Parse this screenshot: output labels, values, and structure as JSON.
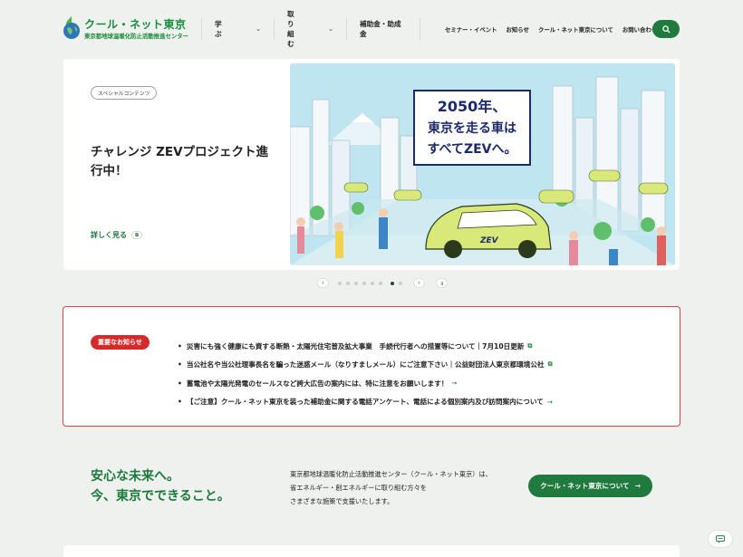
{
  "header": {
    "logo_title": "クール・ネット東京",
    "logo_subtitle": "東京都地球温暖化防止活動推進センター",
    "nav_main": [
      {
        "label": "学ぶ",
        "has_dropdown": true
      },
      {
        "label": "取り組む",
        "has_dropdown": true
      },
      {
        "label": "補助金・助成金",
        "has_dropdown": false
      }
    ],
    "nav_sub": [
      "セミナー・イベント",
      "お知らせ",
      "クール・ネット東京について",
      "お問い合わせ"
    ],
    "search_icon": "search-icon"
  },
  "hero": {
    "tag": "スペシャルコンテンツ",
    "title": "チャレンジ ZEVプロジェクト進行中！",
    "more_label": "詳しく見る",
    "banner_text_line1": "2050年、",
    "banner_text_line2": "東京を走る車は",
    "banner_text_line3": "すべてZEVへ。",
    "car_label": "ZEV"
  },
  "carousel": {
    "prev": "‹",
    "next": "›",
    "pause": "॥",
    "dot_count": 7,
    "active_index": 6
  },
  "notice": {
    "badge": "重要なお知らせ",
    "items": [
      {
        "text": "災害にも強く健康にも資する断熱・太陽光住宅普及拡大事業　手続代行者への措置等について｜7月10日更新",
        "marker": "⧉"
      },
      {
        "text": "当公社名や当公社理事長名を騙った迷惑メール（なりすましメール）にご注意下さい｜公益財団法人東京都環境公社",
        "marker": "⧉"
      },
      {
        "text": "蓄電池や太陽光発電のセールスなど誇大広告の案内には、特に注意をお願いします！",
        "marker": "→"
      },
      {
        "text": "【ご注意】クール・ネット東京を装った補助金に関する電話アンケート、電話による個別案内及び訪問案内について",
        "marker": "→"
      }
    ]
  },
  "about": {
    "heading_line1": "安心な未来へ。",
    "heading_line2": "今、東京でできること。",
    "text_line1": "東京都地球温暖化防止活動推進センター（クール・ネット東京）は、",
    "text_line2": "省エネルギー・創エネルギーに取り組む方々を",
    "text_line3": "さまざまな施策で支援いたします。",
    "button_label": "クール・ネット東京について",
    "button_arrow": "→"
  },
  "colors": {
    "brand_green": "#1f7a3e",
    "alert_red": "#d32b2b",
    "background": "#eef1ee"
  }
}
